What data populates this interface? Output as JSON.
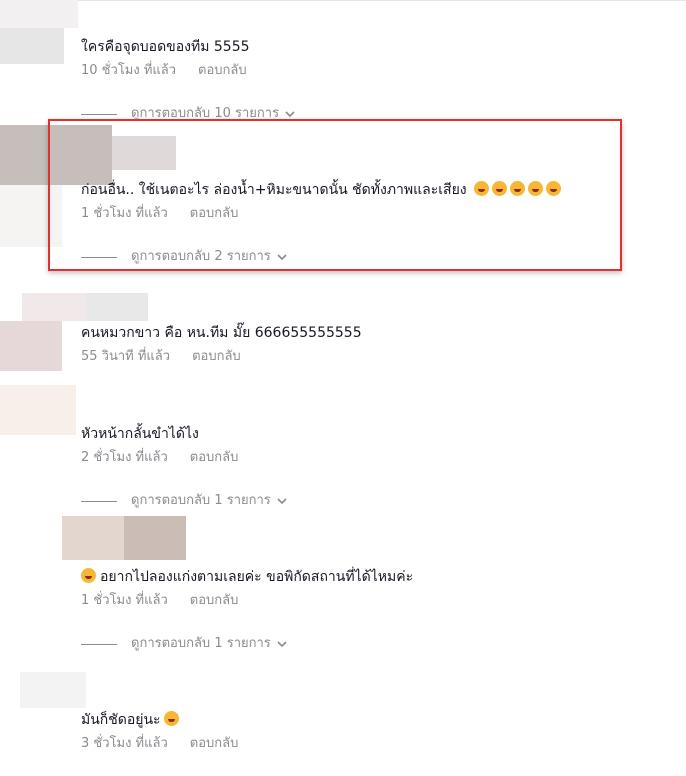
{
  "comments": [
    {
      "text": "ใครคือจุดบอดของทีม 5555",
      "time": "10 ชั่วโมง ที่แล้ว",
      "reply": "ตอบกลับ",
      "replies": "ดูการตอบกลับ 10 รายการ"
    },
    {
      "text": "ก่อนอื่น.. ใช้เนตอะไร ล่องน้ำ+หิมะขนาดนั้น ชัดทั้งภาพและเสียง",
      "emoji_count": 5,
      "time": "1 ชั่วโมง ที่แล้ว",
      "reply": "ตอบกลับ",
      "replies": "ดูการตอบกลับ 2 รายการ"
    },
    {
      "text": "คนหมวกขาว คือ หน.ทีม มั๊ย 666655555555",
      "time": "55 วินาที ที่แล้ว",
      "reply": "ตอบกลับ"
    },
    {
      "text": "หัวหน้ากลั้นขำได้ไง",
      "time": "2 ชั่วโมง ที่แล้ว",
      "reply": "ตอบกลับ",
      "replies": "ดูการตอบกลับ 1 รายการ"
    },
    {
      "text": "อยากไปลองแก่งตามเลยค่ะ ขอพิกัดสถานที่ได้ไหมค่ะ",
      "time": "1 ชั่วโมง ที่แล้ว",
      "reply": "ตอบกลับ",
      "replies": "ดูการตอบกลับ 1 รายการ"
    },
    {
      "text": "มันก็ชัดอยู่นะ",
      "time": "3 ชั่วโมง ที่แล้ว",
      "reply": "ตอบกลับ"
    }
  ],
  "colors": {
    "highlight_border": "#e0312f",
    "muted_text": "#8a8b91",
    "body_text": "#161823"
  }
}
